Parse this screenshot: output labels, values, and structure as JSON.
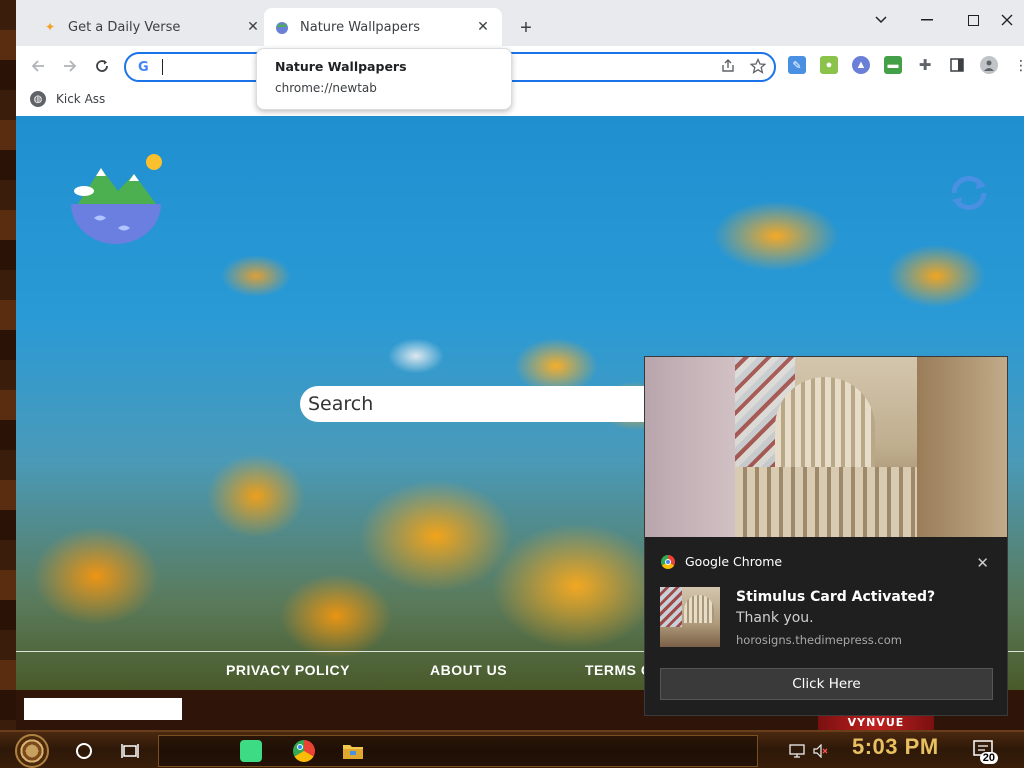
{
  "browser": {
    "tabs": [
      {
        "title": "Get a Daily Verse",
        "active": false,
        "favicon": "sparkle-icon"
      },
      {
        "title": "Nature Wallpapers",
        "active": true,
        "favicon": "globe-icon"
      }
    ],
    "new_tab_symbol": "+",
    "window_controls": {
      "minimize": "—",
      "maximize": "☐",
      "close": "✕",
      "tab_search": "⌄"
    },
    "omnibox": {
      "value": "",
      "google_letter": "G"
    },
    "bookmarks": [
      {
        "label": "Kick Ass",
        "icon": "globe-icon"
      }
    ],
    "tooltip": {
      "title": "Nature Wallpapers",
      "url": "chrome://newtab"
    }
  },
  "page": {
    "search_placeholder": "Search",
    "footer_links": [
      "PRIVACY POLICY",
      "ABOUT US",
      "TERMS O"
    ]
  },
  "notification": {
    "app": "Google Chrome",
    "title": "Stimulus Card Activated?",
    "body": "Thank you.",
    "site": "horosigns.thedimepress.com",
    "button": "Click Here",
    "close": "✕"
  },
  "taskbar": {
    "clock": "5:03 PM",
    "notification_count": "20",
    "banner_text": "VYNVUE"
  }
}
